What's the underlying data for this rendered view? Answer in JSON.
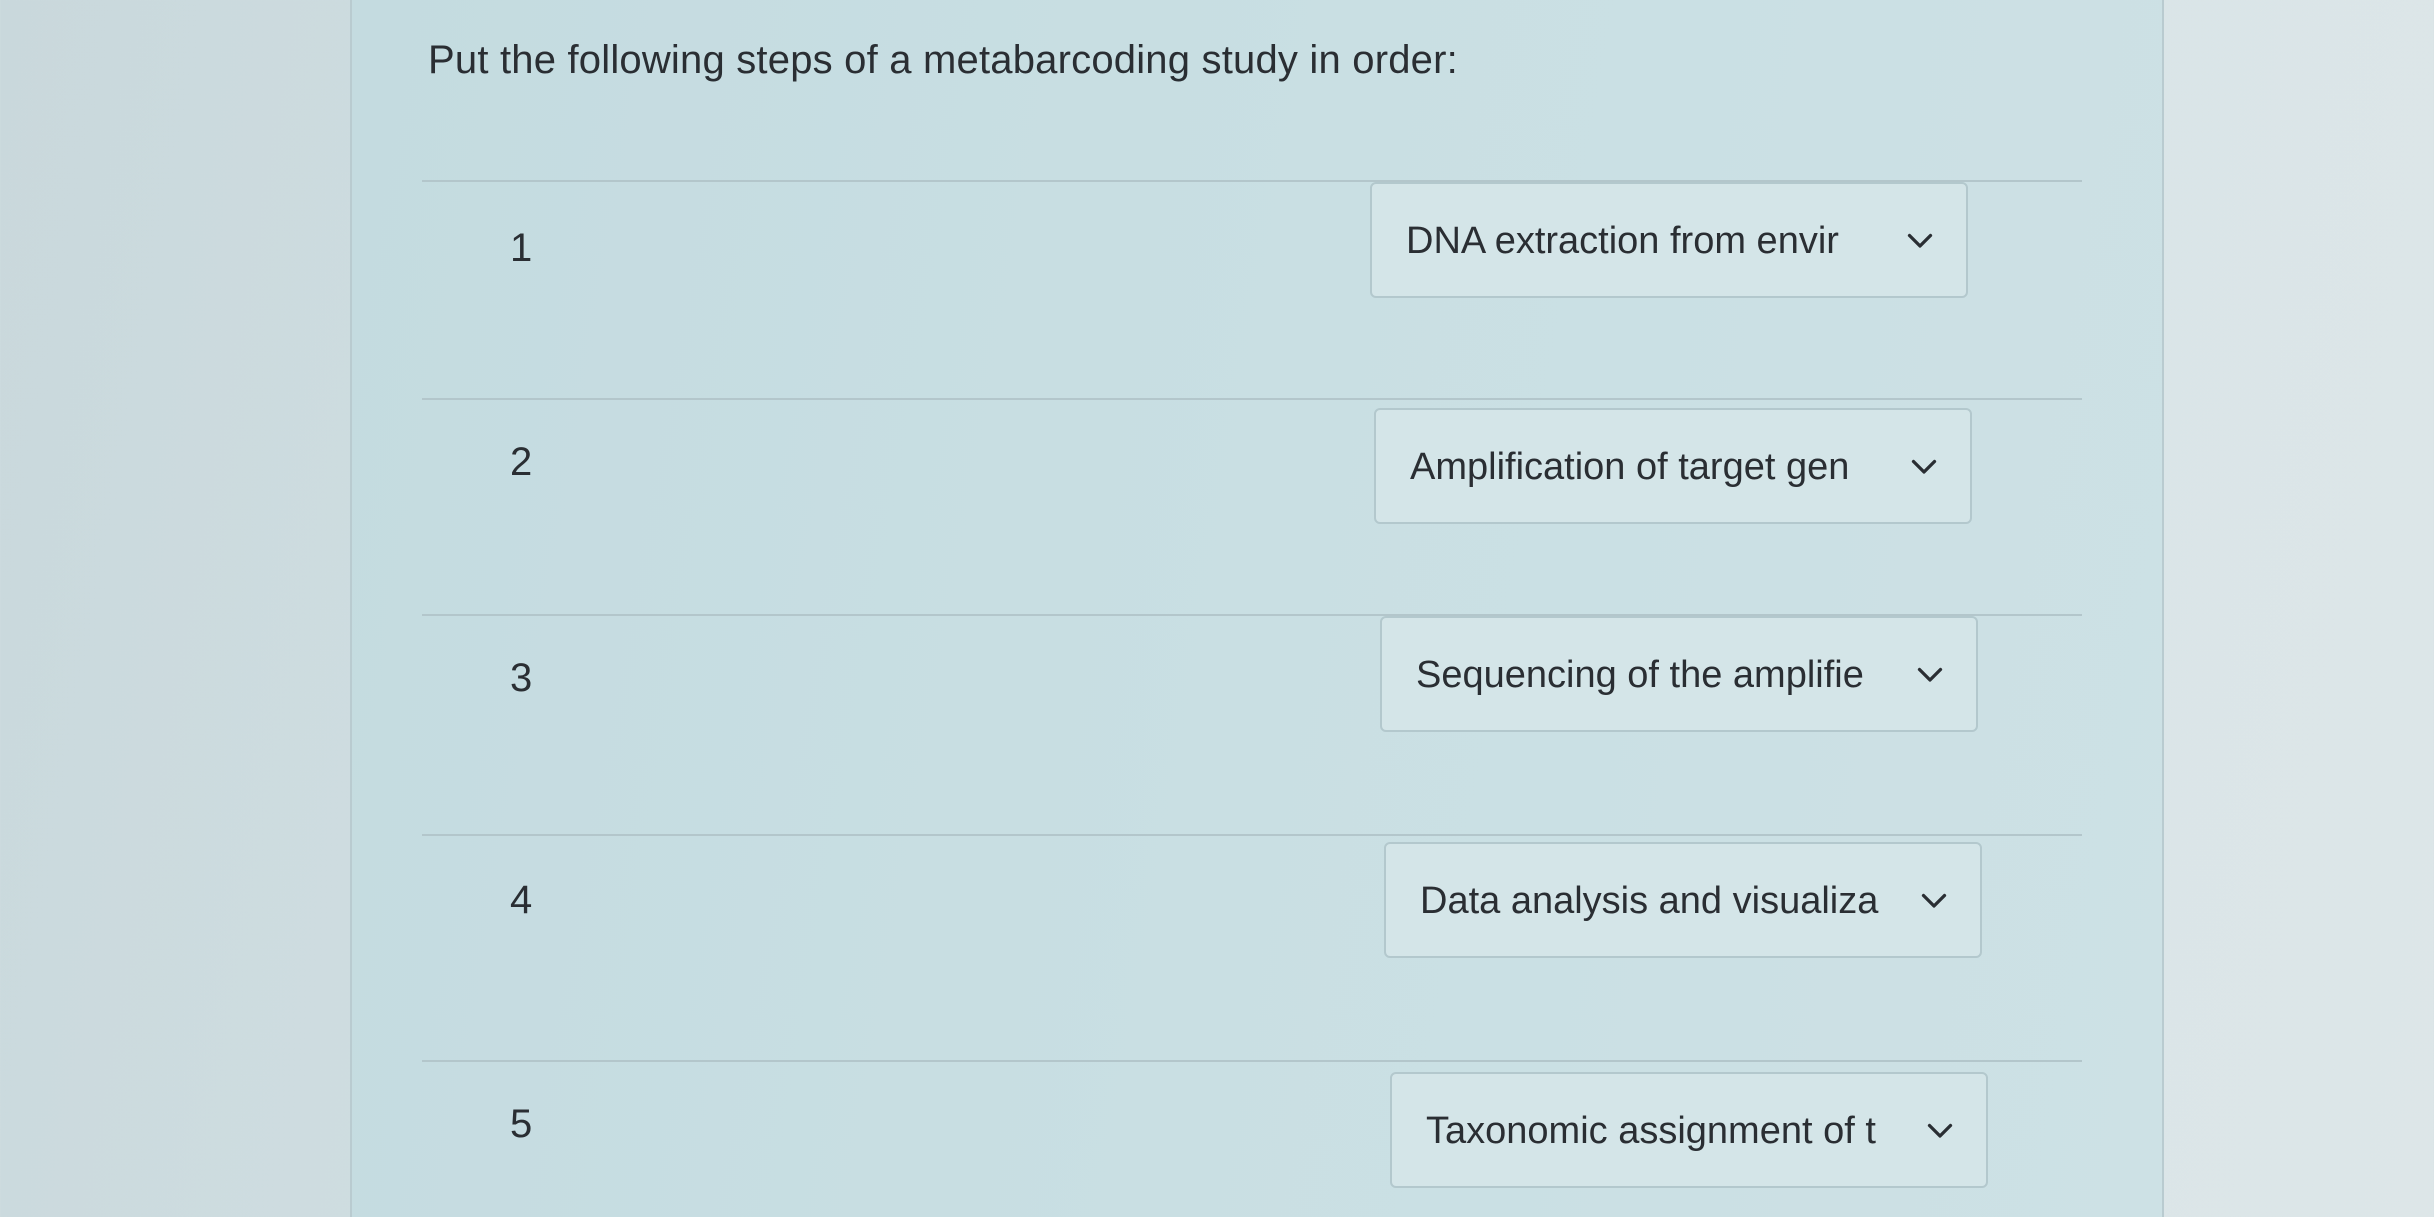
{
  "question": {
    "text": "Put the following steps of a metabarcoding study in order:"
  },
  "rows": [
    {
      "number": "1",
      "selected": "DNA extraction from envir",
      "icon": "chevron-down-icon"
    },
    {
      "number": "2",
      "selected": "Amplification of target gen",
      "icon": "chevron-down-icon"
    },
    {
      "number": "3",
      "selected": "Sequencing of the amplifie",
      "icon": "chevron-down-icon"
    },
    {
      "number": "4",
      "selected": "Data analysis and visualiza",
      "icon": "chevron-down-icon"
    },
    {
      "number": "5",
      "selected": "Taxonomic assignment of t",
      "icon": "chevron-down-icon"
    }
  ],
  "colors": {
    "page_background": "#d3e1e4",
    "panel_background": "#c9dfe3",
    "dropdown_background": "#d4e5e8",
    "text": "#2a2e33",
    "divider": "#b3c6cb"
  }
}
